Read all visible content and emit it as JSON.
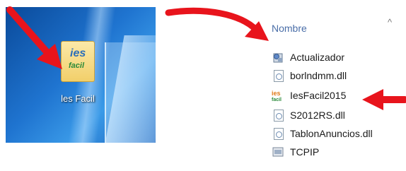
{
  "desktop": {
    "icon_label": "les Facil",
    "icon_logo_top": "ies",
    "icon_logo_bottom": "facil"
  },
  "explorer": {
    "column_header": "Nombre",
    "sort_icon": "chevron-up-icon",
    "files": [
      {
        "name": "Actualizador",
        "icon": "setup-program-icon"
      },
      {
        "name": "borlndmm.dll",
        "icon": "dll-file-icon"
      },
      {
        "name": "IesFacil2015",
        "icon": "iesfacil-app-icon",
        "highlighted": true
      },
      {
        "name": "S2012RS.dll",
        "icon": "dll-file-icon"
      },
      {
        "name": "TablonAnuncios.dll",
        "icon": "dll-file-icon"
      },
      {
        "name": "TCPIP",
        "icon": "program-icon"
      }
    ]
  },
  "colors": {
    "arrow": "#e8141c",
    "header_text": "#4a6ea8",
    "desktop_blue": "#1f74d0"
  }
}
